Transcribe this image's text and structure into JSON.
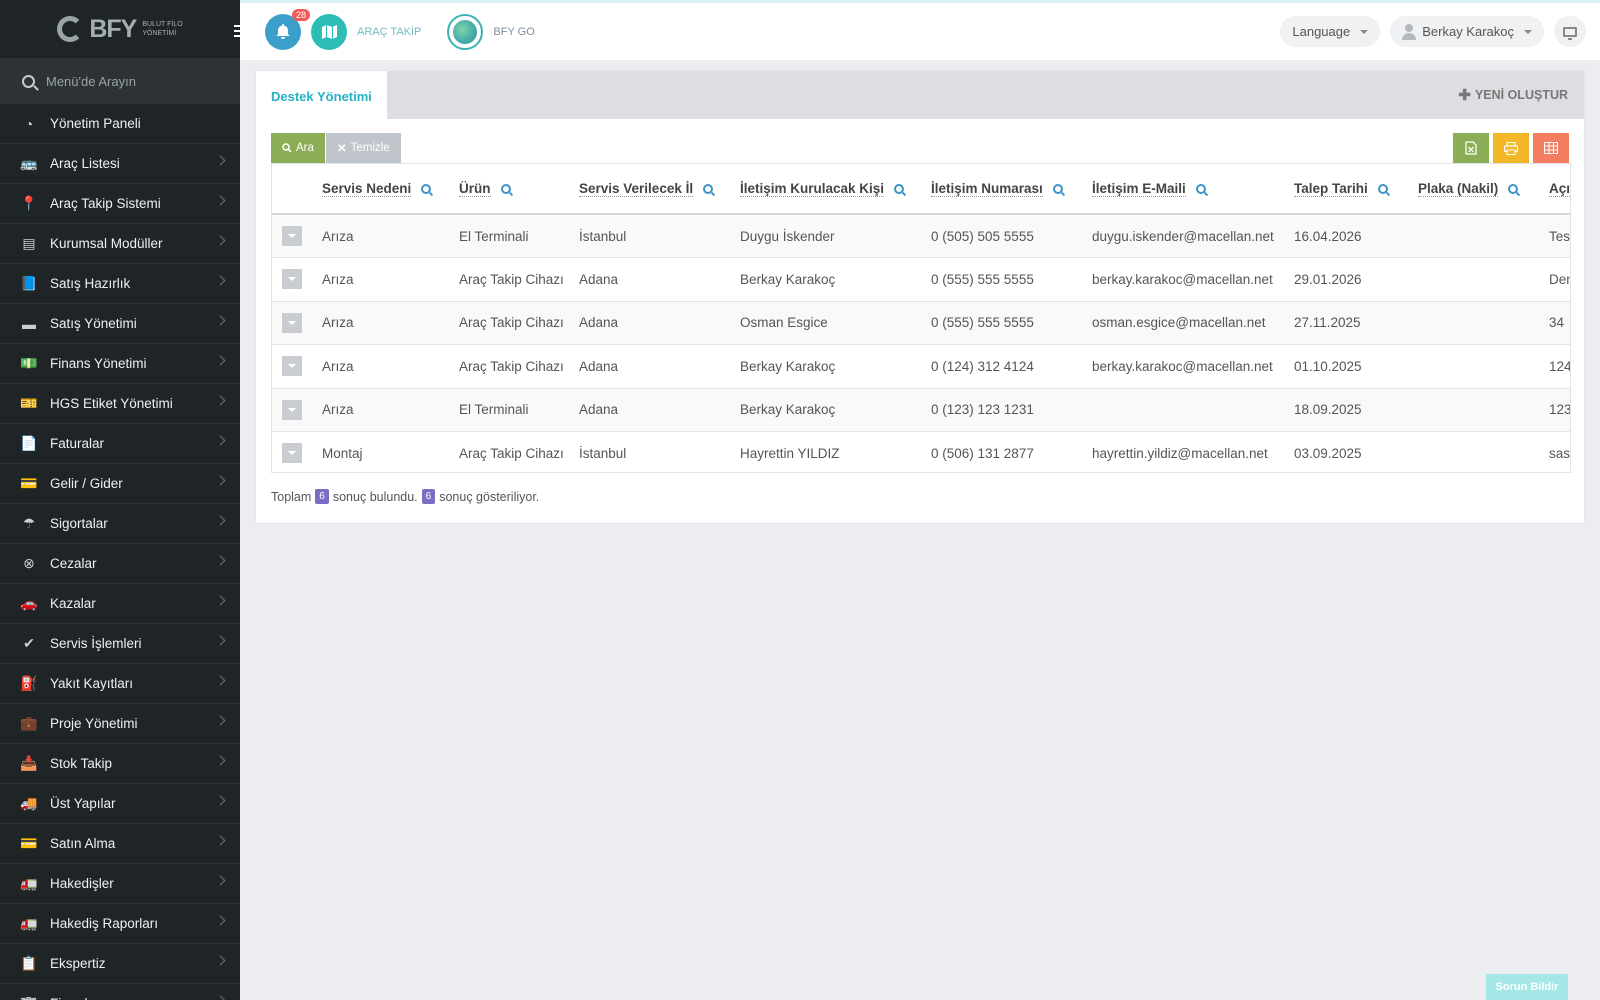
{
  "logo": {
    "name": "BFY",
    "subtitle_line1": "BULUT FİLO",
    "subtitle_line2": "YÖNETİMİ"
  },
  "sidebar": {
    "search_placeholder": "Menü'de Arayın",
    "items": [
      {
        "label": "Yönetim Paneli",
        "icon": "dashboard-icon",
        "glyph": "◔",
        "chevron": false
      },
      {
        "label": "Araç Listesi",
        "icon": "bus-icon",
        "glyph": "🚌",
        "chevron": true
      },
      {
        "label": "Araç Takip Sistemi",
        "icon": "map-pin-icon",
        "glyph": "📍",
        "chevron": true
      },
      {
        "label": "Kurumsal Modüller",
        "icon": "server-icon",
        "glyph": "▤",
        "chevron": true
      },
      {
        "label": "Satış Hazırlık",
        "icon": "book-icon",
        "glyph": "📘",
        "chevron": true
      },
      {
        "label": "Satış Yönetimi",
        "icon": "card-icon",
        "glyph": "▬",
        "chevron": true
      },
      {
        "label": "Finans Yönetimi",
        "icon": "money-icon",
        "glyph": "💵",
        "chevron": true
      },
      {
        "label": "HGS Etiket Yönetimi",
        "icon": "ticket-icon",
        "glyph": "🎫",
        "chevron": true
      },
      {
        "label": "Faturalar",
        "icon": "file-icon",
        "glyph": "📄",
        "chevron": true
      },
      {
        "label": "Gelir / Gider",
        "icon": "wallet-icon",
        "glyph": "💳",
        "chevron": true
      },
      {
        "label": "Sigortalar",
        "icon": "umbrella-icon",
        "glyph": "☂",
        "chevron": true
      },
      {
        "label": "Cezalar",
        "icon": "x-circle-icon",
        "glyph": "⊗",
        "chevron": true
      },
      {
        "label": "Kazalar",
        "icon": "car-crash-icon",
        "glyph": "🚗",
        "chevron": true
      },
      {
        "label": "Servis İşlemleri",
        "icon": "check-circle-icon",
        "glyph": "✔",
        "chevron": true
      },
      {
        "label": "Yakıt Kayıtları",
        "icon": "gas-pump-icon",
        "glyph": "⛽",
        "chevron": true
      },
      {
        "label": "Proje Yönetimi",
        "icon": "briefcase-icon",
        "glyph": "💼",
        "chevron": true
      },
      {
        "label": "Stok Takip",
        "icon": "inbox-icon",
        "glyph": "📥",
        "chevron": true
      },
      {
        "label": "Üst Yapılar",
        "icon": "truck-icon",
        "glyph": "🚚",
        "chevron": true
      },
      {
        "label": "Satın Alma",
        "icon": "credit-card-icon",
        "glyph": "💳",
        "chevron": true
      },
      {
        "label": "Hakedişler",
        "icon": "truck-icon",
        "glyph": "🚛",
        "chevron": true
      },
      {
        "label": "Hakediş Raporları",
        "icon": "truck-icon",
        "glyph": "🚛",
        "chevron": true
      },
      {
        "label": "Ekspertiz",
        "icon": "list-icon",
        "glyph": "📋",
        "chevron": true
      },
      {
        "label": "Firmalar",
        "icon": "building-icon",
        "glyph": "🏢",
        "chevron": true
      }
    ]
  },
  "topbar": {
    "notification_count": "28",
    "arac_takip_label": "ARAÇ TAKİP",
    "bfy_go_label": "BFY GO",
    "language_label": "Language",
    "user_name": "Berkay Karakoç"
  },
  "panel": {
    "tab_label": "Destek Yönetimi",
    "new_button_label": "YENİ OLUŞTUR",
    "search_button_label": "Ara",
    "clear_button_label": "Temizle"
  },
  "table": {
    "columns": [
      "Servis Nedeni",
      "Ürün",
      "Servis Verilecek İl",
      "İletişim Kurulacak Kişi",
      "İletişim Numarası",
      "İletişim E-Maili",
      "Talep Tarihi",
      "Plaka (Nakil)",
      "Açıl"
    ],
    "rows": [
      [
        "Arıza",
        "El Terminali",
        "İstanbul",
        "Duygu İskender",
        "0 (505) 505 5555",
        "duygu.iskender@macellan.net",
        "16.04.2026",
        "",
        "Test"
      ],
      [
        "Arıza",
        "Araç Takip Cihazı",
        "Adana",
        "Berkay Karakoç",
        "0 (555) 555 5555",
        "berkay.karakoc@macellan.net",
        "29.01.2026",
        "",
        "Den"
      ],
      [
        "Arıza",
        "Araç Takip Cihazı",
        "Adana",
        "Osman Esgice",
        "0 (555) 555 5555",
        "osman.esgice@macellan.net",
        "27.11.2025",
        "",
        "34"
      ],
      [
        "Arıza",
        "Araç Takip Cihazı",
        "Adana",
        "Berkay Karakoç",
        "0 (124) 312 4124",
        "berkay.karakoc@macellan.net",
        "01.10.2025",
        "",
        "124"
      ],
      [
        "Arıza",
        "El Terminali",
        "Adana",
        "Berkay Karakoç",
        "0 (123) 123 1231",
        "",
        "18.09.2025",
        "",
        "123"
      ],
      [
        "Montaj",
        "Araç Takip Cihazı",
        "İstanbul",
        "Hayrettin YILDIZ",
        "0 (506) 131 2877",
        "hayrettin.yildiz@macellan.net",
        "03.09.2025",
        "",
        "sasl"
      ]
    ]
  },
  "summary": {
    "prefix": "Toplam",
    "total": "6",
    "middle": "sonuç bulundu.",
    "shown": "6",
    "suffix": "sonuç gösteriliyor."
  },
  "report_button_label": "Sorun Bildir",
  "colors": {
    "accent": "#26b2c3",
    "sidebar_bg": "#1f2427",
    "green": "#8bad55",
    "yellow": "#f2b827",
    "orange": "#f37e5f",
    "purple": "#7d6dc2"
  }
}
